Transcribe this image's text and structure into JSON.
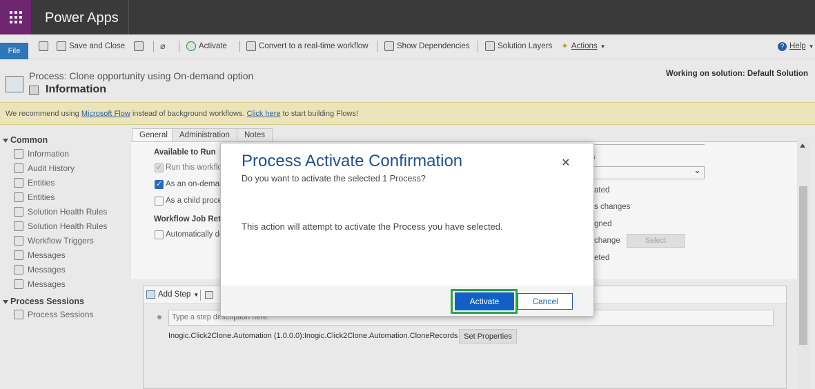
{
  "app": {
    "name": "Power Apps"
  },
  "ribbon": {
    "file": "File",
    "save_close": "Save and Close",
    "activate": "Activate",
    "convert": "Convert to a real-time workflow",
    "show_dependencies": "Show Dependencies",
    "solution_layers": "Solution Layers",
    "actions": "Actions",
    "help": "Help"
  },
  "header": {
    "process_title": "Process: Clone opportunity using On-demand option",
    "section_title": "Information",
    "working_on": "Working on solution: Default Solution"
  },
  "notice": {
    "part1": "We recommend using ",
    "link1": "Microsoft Flow",
    "part2": " instead of background workflows. ",
    "link2": "Click here",
    "part3": " to start building Flows!"
  },
  "sidebar": {
    "common_label": "Common",
    "common_items": [
      "Information",
      "Audit History",
      "Entities",
      "Entities",
      "Solution Health Rules",
      "Solution Health Rules",
      "Workflow Triggers",
      "Messages",
      "Messages",
      "Messages"
    ],
    "process_sessions_label": "Process Sessions",
    "process_sessions_items": [
      "Process Sessions"
    ]
  },
  "tabs": [
    "General",
    "Administration",
    "Notes"
  ],
  "form": {
    "available_to_run": "Available to Run",
    "run_this_workflow": "Run this workflo",
    "as_on_demand": "As an on-deman",
    "as_child": "As a child proces",
    "job_retention": "Workflow Job Rete",
    "auto_delete": "Automatically de",
    "right_header_fragment": "s",
    "right_labels": [
      "ated",
      "s changes",
      "gned",
      "change",
      "eted"
    ],
    "select_button": "Select"
  },
  "steps": {
    "add_step": "Add Step",
    "description_placeholder": "Type a step description here.",
    "step_text": "Inogic.Click2Clone.Automation (1.0.0.0):Inogic.Click2Clone.Automation.CloneRecords",
    "set_properties": "Set Properties"
  },
  "dialog": {
    "title": "Process Activate Confirmation",
    "subtitle": "Do you want to activate the selected 1 Process?",
    "message": "This action will attempt to activate the Process you have selected.",
    "activate": "Activate",
    "cancel": "Cancel",
    "close_glyph": "×"
  },
  "colors": {
    "topbar": "#3d3d3d",
    "waffle": "#742774",
    "accent_blue": "#1260c7",
    "highlight_green": "#28a745"
  }
}
